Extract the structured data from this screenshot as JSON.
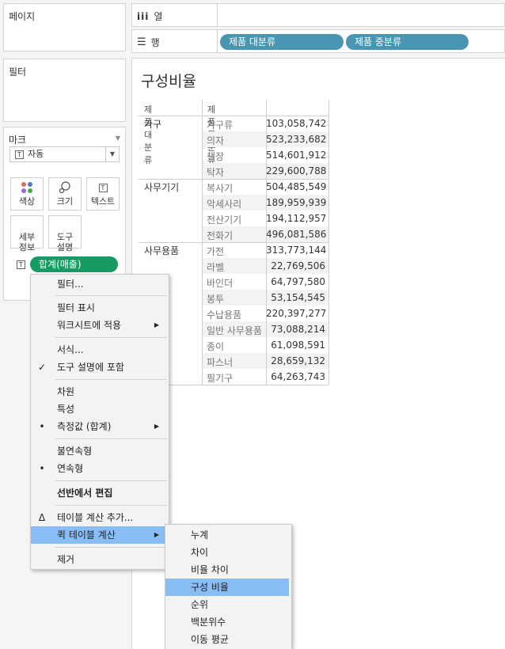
{
  "panels": {
    "pages": "페이지",
    "filters": "필터",
    "marks": "마크"
  },
  "shelves": {
    "columns_label": "열",
    "rows_label": "행",
    "row_pills": [
      "제품 대분류",
      "제품 중분류"
    ]
  },
  "marks": {
    "type": "자동",
    "buttons": {
      "color": "색상",
      "size": "크기",
      "text": "텍스트",
      "detail": "세부\n정보",
      "tooltip": "도구\n설명"
    },
    "pill": "합계(매출)"
  },
  "view": {
    "title": "구성비율",
    "headers": [
      "제품 대분류",
      "제품 중분류"
    ],
    "groups": [
      {
        "category": "가구",
        "rows": [
          {
            "sub": "가구류",
            "value": "103,058,742"
          },
          {
            "sub": "의자",
            "value": "523,233,682"
          },
          {
            "sub": "책장",
            "value": "514,601,912"
          },
          {
            "sub": "탁자",
            "value": "229,600,788"
          }
        ]
      },
      {
        "category": "사무기기",
        "rows": [
          {
            "sub": "복사기",
            "value": "504,485,549"
          },
          {
            "sub": "악세사리",
            "value": "189,959,939"
          },
          {
            "sub": "전산기기",
            "value": "194,112,957"
          },
          {
            "sub": "전화기",
            "value": "496,081,586"
          }
        ]
      },
      {
        "category": "사무용품",
        "rows": [
          {
            "sub": "가전",
            "value": "313,773,144"
          },
          {
            "sub": "라벨",
            "value": "22,769,506"
          },
          {
            "sub": "바인더",
            "value": "64,797,580"
          },
          {
            "sub": "봉투",
            "value": "53,154,545"
          },
          {
            "sub": "수납용품",
            "value": "220,397,277"
          },
          {
            "sub": "일반 사무용품",
            "value": "73,088,214"
          },
          {
            "sub": "종이",
            "value": "61,098,591"
          },
          {
            "sub": "파스너",
            "value": "28,659,132"
          },
          {
            "sub": "필기구",
            "value": "64,263,743"
          }
        ]
      }
    ]
  },
  "context_menu": {
    "filter": "필터...",
    "show_filter": "필터 표시",
    "apply_to_worksheets": "워크시트에 적용",
    "format": "서식...",
    "include_in_tooltip": "도구 설명에 포함",
    "dimension": "차원",
    "attribute": "특성",
    "measure": "측정값 (합계)",
    "discrete": "불연속형",
    "continuous": "연속형",
    "edit_in_shelf": "선반에서 편집",
    "add_table_calc": "테이블 계산 추가...",
    "quick_table_calc": "퀵 테이블 계산",
    "remove": "제거",
    "marks": {
      "check": "✓",
      "bullet": "•",
      "delta": "Δ",
      "arrow": "▶"
    }
  },
  "submenu": [
    "누계",
    "차이",
    "비율 차이",
    "구성 비율",
    "순위",
    "백분위수",
    "이동 평균"
  ],
  "colors": {
    "pill_blue": "#4996b2",
    "pill_green": "#169b62",
    "highlight": "#88bef5"
  }
}
